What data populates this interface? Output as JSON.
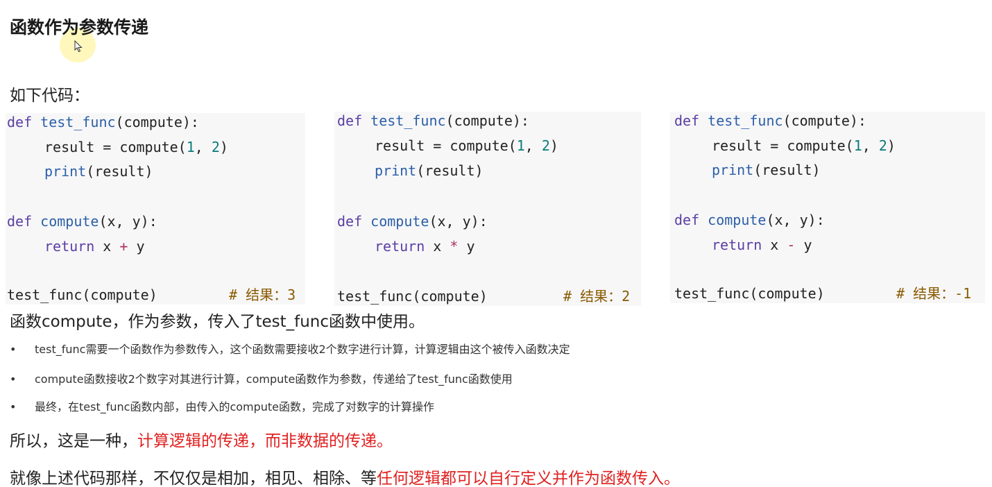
{
  "slide": {
    "title": "函数作为参数传递",
    "intro": "如下代码：",
    "caption": "函数compute，作为参数，传入了test_func函数中使用。"
  },
  "code_blocks": [
    {
      "def_kw": "def",
      "test_func_name": "test_func",
      "test_func_rest": "(compute):",
      "result_lhs": "result = compute(",
      "arg1": "1",
      "comma": ", ",
      "arg2": "2",
      "close": ")",
      "print_kw": "print",
      "print_rest": "(result)",
      "compute_def_kw": "def",
      "compute_name": "compute",
      "compute_rest": "(x, y):",
      "return_kw": "return",
      "return_x": " x ",
      "operator": "+",
      "return_y": " y",
      "call": "test_func(compute)",
      "comment": "# 结果：3"
    },
    {
      "def_kw": "def",
      "test_func_name": "test_func",
      "test_func_rest": "(compute):",
      "result_lhs": "result = compute(",
      "arg1": "1",
      "comma": ", ",
      "arg2": "2",
      "close": ")",
      "print_kw": "print",
      "print_rest": "(result)",
      "compute_def_kw": "def",
      "compute_name": "compute",
      "compute_rest": "(x, y):",
      "return_kw": "return",
      "return_x": " x ",
      "operator": "*",
      "return_y": " y",
      "call": "test_func(compute)",
      "comment": "# 结果：2"
    },
    {
      "def_kw": "def",
      "test_func_name": "test_func",
      "test_func_rest": "(compute):",
      "result_lhs": "result = compute(",
      "arg1": "1",
      "comma": ", ",
      "arg2": "2",
      "close": ")",
      "print_kw": "print",
      "print_rest": "(result)",
      "compute_def_kw": "def",
      "compute_name": "compute",
      "compute_rest": "(x, y):",
      "return_kw": "return",
      "return_x": " x ",
      "operator": "-",
      "return_y": " y",
      "call": "test_func(compute)",
      "comment": "# 结果：-1"
    }
  ],
  "bullets": [
    {
      "marker": "•",
      "text": "test_func需要一个函数作为参数传入，这个函数需要接收2个数字进行计算，计算逻辑由这个被传入函数决定"
    },
    {
      "marker": "•",
      "text": "compute函数接收2个数字对其进行计算，compute函数作为参数，传递给了test_func函数使用"
    },
    {
      "marker": "•",
      "text": "最终，在test_func函数内部，由传入的compute函数，完成了对数字的计算操作"
    }
  ],
  "conclusion1": {
    "normal": "所以，这是一种，",
    "highlight": "计算逻辑的传递，而非数据的传递。"
  },
  "conclusion2": {
    "normal": "就像上述代码那样，不仅仅是相加，相见、相除、等",
    "highlight": "任何逻辑都可以自行定义并作为函数传入。"
  },
  "colors": {
    "highlight_red": "#e02020",
    "code_background": "#f7f7f8",
    "keyword": "#5b3ea3",
    "function_name": "#2b5fa7",
    "number": "#0a7a7a",
    "comment": "#8a5a00"
  }
}
